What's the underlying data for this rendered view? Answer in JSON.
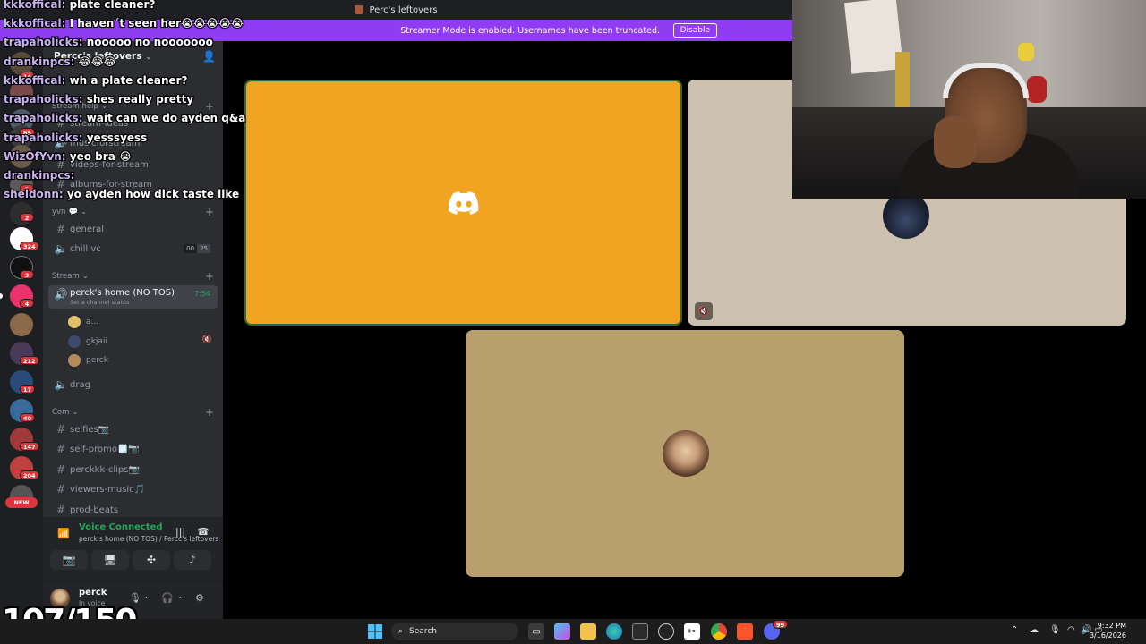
{
  "window": {
    "title": "Perc's leftovers"
  },
  "banner": {
    "message": "Streamer Mode is enabled. Usernames have been truncated.",
    "disable_label": "Disable"
  },
  "server": {
    "name": "Percc's leftovers"
  },
  "rail": {
    "badges": [
      "14",
      "5",
      "65",
      "2",
      "3",
      "5",
      "2",
      "324",
      "3",
      "4",
      "212",
      "17",
      "40",
      "147",
      "204"
    ],
    "new_label": "NEW"
  },
  "categories": {
    "stream_help": "Stream help",
    "yvn": "yvn",
    "stream": "Stream",
    "com": "Com"
  },
  "channels": {
    "stream_ideas": "stream-ideas",
    "music_for_stream": "musicforstream",
    "videos_for_stream": "videos-for-stream",
    "albums_for_stream": "albums-for-stream",
    "general": "general",
    "chill_vc": "chill vc",
    "chill_vc_count": "00",
    "chill_vc_limit": "25",
    "active_voice": "perck's home (NO TOS)",
    "active_timer": "7:54",
    "active_status": "Set a channel status",
    "drag": "drag",
    "selfies": "selfies📷",
    "self_promo": "self-promo🗒️📷",
    "clips": "perckkk-clips📷",
    "viewers_music": "viewers-music🎵",
    "prod_beats": "prod-beats"
  },
  "voice_users": [
    "a...",
    "gkjaii",
    "perck"
  ],
  "voice_panel": {
    "status": "Voice Connected",
    "location": "perck's home (NO TOS) / Percc's leftovers"
  },
  "user": {
    "name": "perck",
    "status": "In voice"
  },
  "chat": [
    {
      "user": "kkkoffical:",
      "text": "plate cleaner?"
    },
    {
      "user": "kkkoffical:",
      "text": "I haven´t seen her😭😭😭😭😭"
    },
    {
      "user": "trapaholicks:",
      "text": "nooooo no nooooooo"
    },
    {
      "user": "drankinpcs:",
      "text": "😂😂😂"
    },
    {
      "user": "kkkoffical:",
      "text": "wh a plate cleaner?"
    },
    {
      "user": "trapaholicks:",
      "text": "shes really pretty"
    },
    {
      "user": "trapaholicks:",
      "text": "wait can we do ayden q&a"
    },
    {
      "user": "trapaholicks:",
      "text": "yesssyess"
    },
    {
      "user": "WizOfYvn:",
      "text": "yeo bra 😭"
    },
    {
      "user": "drankinpcs:",
      "text": ""
    },
    {
      "user": "sheldonn:",
      "text": "yo ayden how dick taste like"
    }
  ],
  "goal": {
    "text": "107/150"
  },
  "taskbar": {
    "search_placeholder": "Search",
    "time": "9:32 PM",
    "date": "3/16/2026",
    "discord_badge": "99"
  },
  "colors": {
    "banner": "#8f3cf2",
    "tile_orange": "#f0a422",
    "tile_beige": "#ccc1ae",
    "tile_tan": "#b8a06e",
    "voice_green": "#23a55a"
  }
}
